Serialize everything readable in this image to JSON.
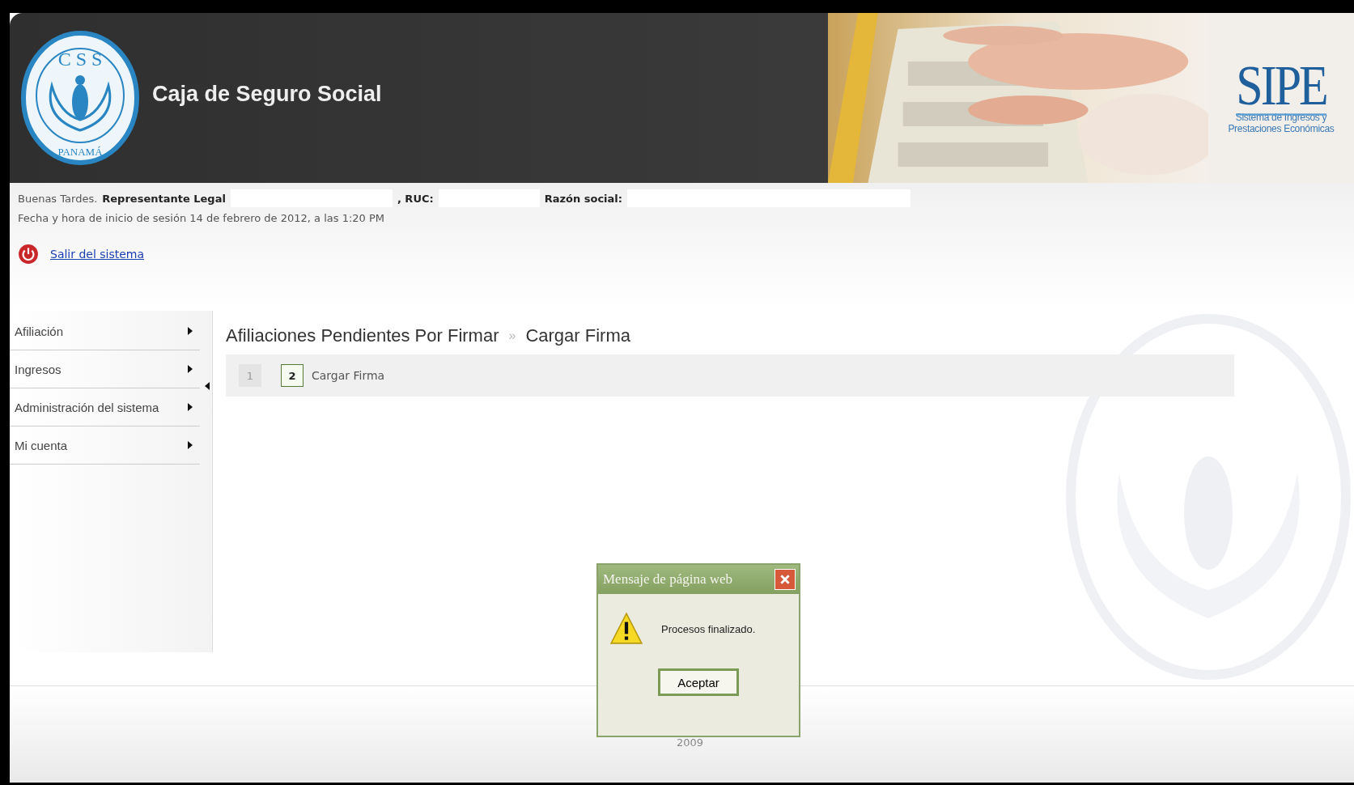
{
  "header": {
    "logo": {
      "top_text": "C S S",
      "bottom_text": "PANAMÁ"
    },
    "title": "Caja de Seguro Social",
    "sipe": {
      "name": "SIPE",
      "subtitle_lines": [
        "Sistema de Ingresos y",
        "Prestaciones Económicas"
      ]
    }
  },
  "session": {
    "greeting": "Buenas Tardes.",
    "role": "Representante Legal",
    "ruc_label": ", RUC:",
    "razon_label": "Razón social:",
    "login_info": "Fecha y hora de inicio de sesión 14 de febrero de 2012, a las 1:20 PM",
    "logout_link": "Salir del sistema"
  },
  "sidebar": {
    "items": [
      {
        "label": "Afiliación"
      },
      {
        "label": "Ingresos"
      },
      {
        "label": "Administración del sistema"
      },
      {
        "label": "Mi cuenta"
      }
    ]
  },
  "breadcrumb": {
    "items": [
      "Afiliaciones Pendientes Por Firmar",
      "Cargar Firma"
    ],
    "separator": "»"
  },
  "steps": [
    {
      "number": "1",
      "selected": false
    },
    {
      "number": "2",
      "selected": true,
      "label": "Cargar Firma"
    }
  ],
  "footer": {
    "year": "2009"
  },
  "dialog": {
    "title": "Mensaje de página web",
    "message": "Procesos finalizado.",
    "button": "Aceptar"
  }
}
